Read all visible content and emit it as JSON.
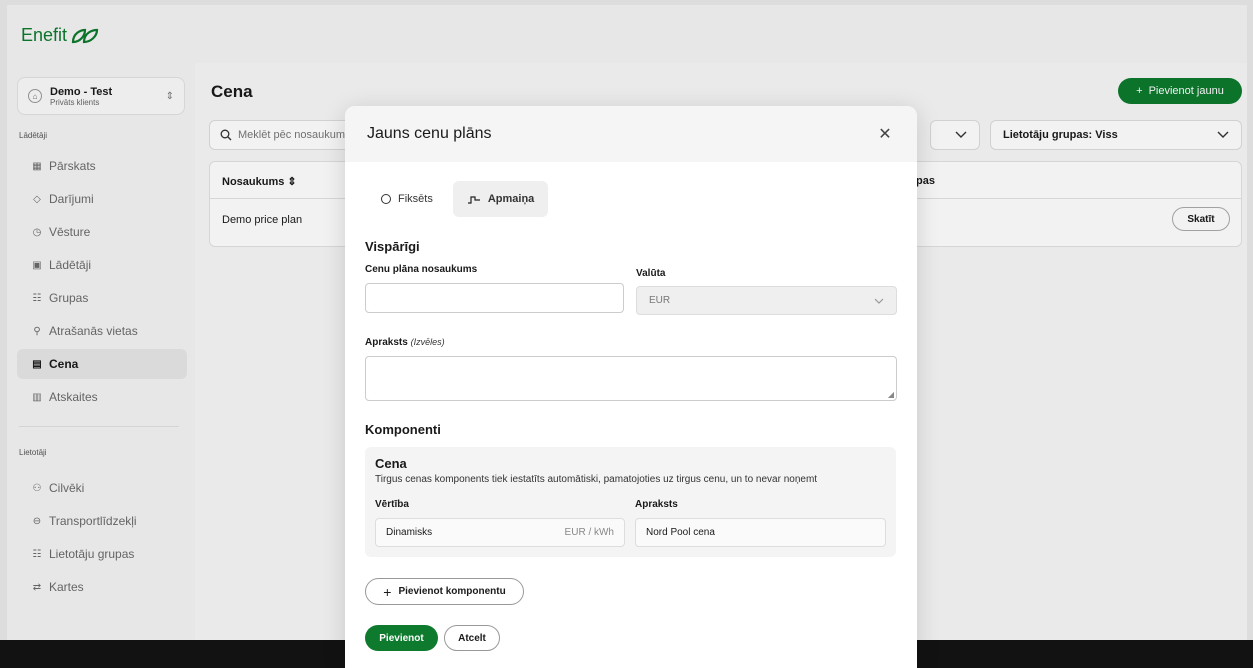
{
  "brand": {
    "name": "Enefit",
    "color": "#0d7a2e"
  },
  "account": {
    "name": "Demo - Test",
    "type": "Privāts klients",
    "avatar_icon": "home-icon"
  },
  "sidebar": {
    "section_chargers": "Lādētāji",
    "section_users": "Lietotāji",
    "items": [
      {
        "label": "Pārskats",
        "icon": "grid-icon"
      },
      {
        "label": "Darījumi",
        "icon": "diamond-icon"
      },
      {
        "label": "Vēsture",
        "icon": "clock-icon"
      },
      {
        "label": "Lādētāji",
        "icon": "charger-icon"
      },
      {
        "label": "Grupas",
        "icon": "groups-icon"
      },
      {
        "label": "Atrašanās vietas",
        "icon": "location-icon"
      },
      {
        "label": "Cena",
        "icon": "price-icon",
        "active": true
      },
      {
        "label": "Atskaites",
        "icon": "chart-icon"
      },
      {
        "label": "Cilvēki",
        "icon": "people-icon"
      },
      {
        "label": "Transportlīdzekļi",
        "icon": "car-icon"
      },
      {
        "label": "Lietotāju grupas",
        "icon": "user-groups-icon"
      },
      {
        "label": "Kartes",
        "icon": "card-icon"
      }
    ]
  },
  "main": {
    "title": "Cena",
    "add_button": "Pievienot jaunu",
    "search_placeholder": "Meklēt pēc nosaukuma",
    "filter_user_groups": "Lietotāju grupas:  Viss",
    "table": {
      "col_name": "Nosaukums",
      "col_groups": "pas",
      "rows": [
        {
          "name": "Demo price plan",
          "action": "Skatīt"
        }
      ]
    }
  },
  "modal": {
    "title": "Jauns cenu plāns",
    "tabs": [
      {
        "label": "Fiksēts",
        "active": false
      },
      {
        "label": "Apmaiņa",
        "active": true
      }
    ],
    "general_heading": "Vispārīgi",
    "name_label": "Cenu plāna nosaukums",
    "name_value": "",
    "currency_label": "Valūta",
    "currency_value": "EUR",
    "description_label": "Apraksts",
    "description_optional": "(Izvēles)",
    "description_value": "",
    "components_heading": "Komponenti",
    "component": {
      "title": "Cena",
      "description": "Tirgus cenas komponents tiek iestatīts automātiski, pamatojoties uz tirgus cenu, un to nevar noņemt",
      "value_label": "Vērtība",
      "value": "Dinamisks",
      "unit": "EUR / kWh",
      "desc_label": "Apraksts",
      "desc_value": "Nord Pool cena"
    },
    "add_component_button": "Pievienot komponentu",
    "submit_button": "Pievienot",
    "cancel_button": "Atcelt"
  }
}
